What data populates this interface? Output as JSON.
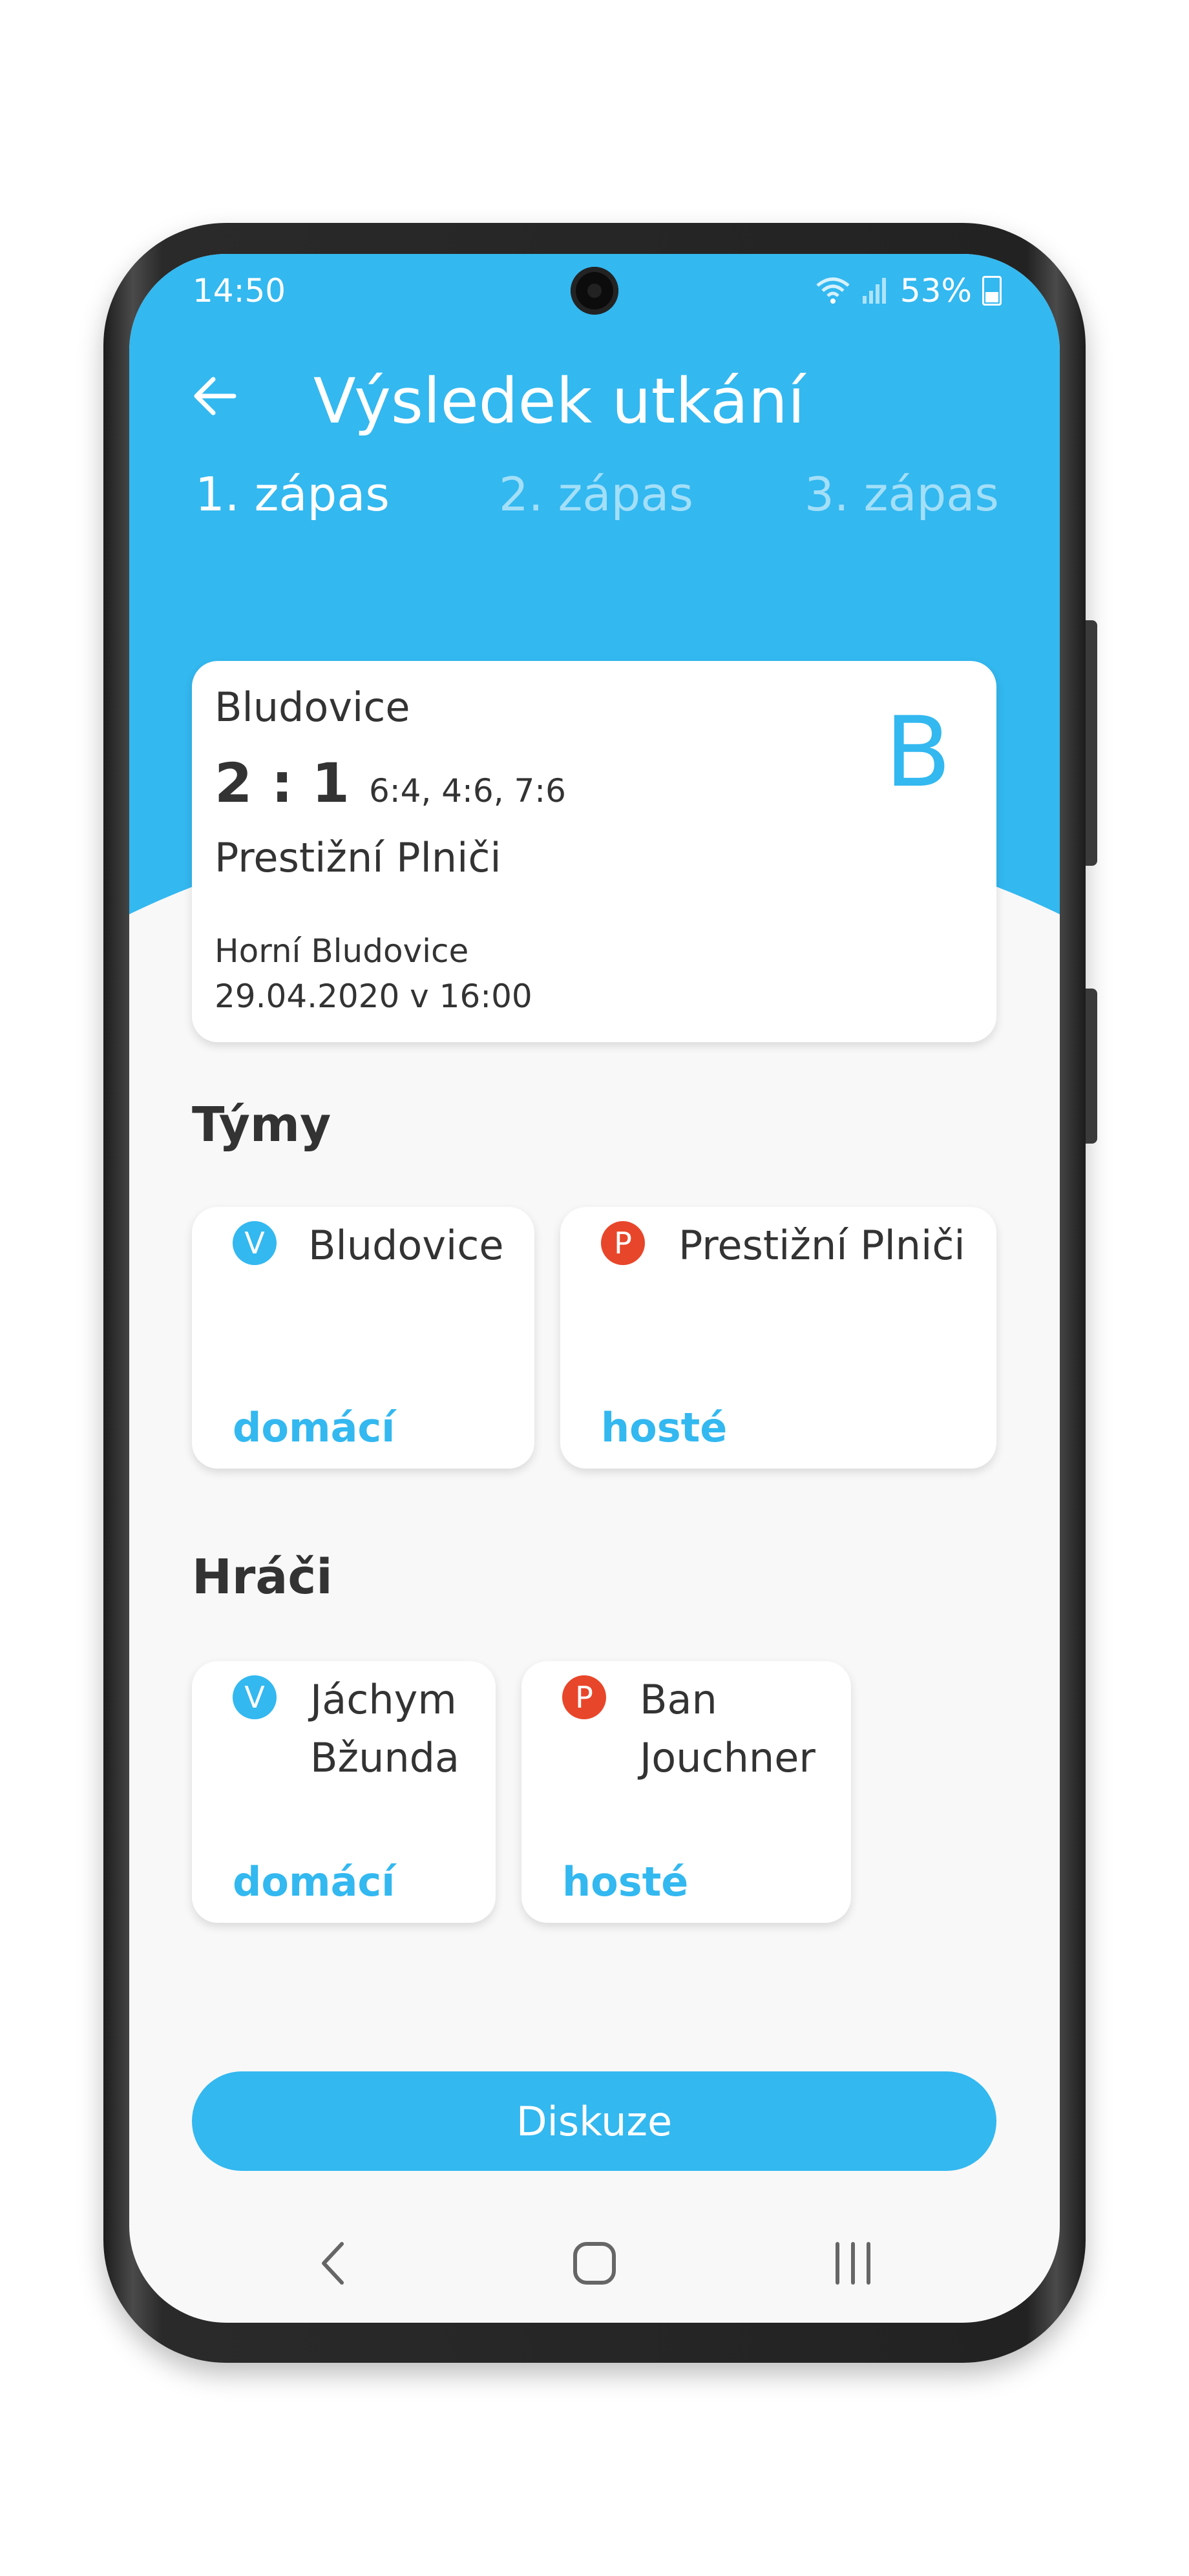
{
  "status": {
    "time": "14:50",
    "battery": "53%"
  },
  "header": {
    "title": "Výsledek utkání",
    "tabs": [
      {
        "label": "1. zápas",
        "active": true
      },
      {
        "label": "2. zápas",
        "active": false
      },
      {
        "label": "3. zápas",
        "active": false
      }
    ]
  },
  "match": {
    "home_team": "Bludovice",
    "score": "2 : 1",
    "sets": "6:4, 4:6, 7:6",
    "away_team": "Prestižní Plniči",
    "venue": "Horní Bludovice",
    "datetime": "29.04.2020 v 16:00",
    "league_letter": "B"
  },
  "teams": {
    "title": "Týmy",
    "items": [
      {
        "badge": "V",
        "name": "Bludovice",
        "role": "domácí"
      },
      {
        "badge": "P",
        "name": "Prestižní Plniči",
        "role": "hosté"
      }
    ]
  },
  "players": {
    "title": "Hráči",
    "items": [
      {
        "badge": "V",
        "name_line1": "Jáchym",
        "name_line2": "Bžunda",
        "role": "domácí"
      },
      {
        "badge": "P",
        "name_line1": "Ban",
        "name_line2": "Jouchner",
        "role": "hosté"
      }
    ]
  },
  "actions": {
    "discuss_label": "Diskuze"
  },
  "colors": {
    "accent": "#33b8f0",
    "away_badge": "#e8462a",
    "background": "#f8f8f8"
  }
}
